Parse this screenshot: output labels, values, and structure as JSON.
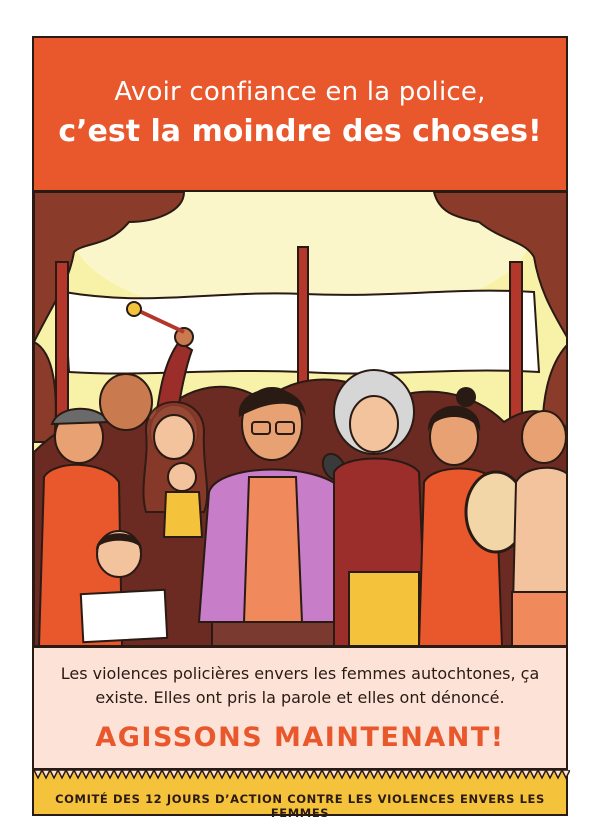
{
  "banner": {
    "line1": "Avoir confiance en la police,",
    "line2": "c’est la moindre des choses!"
  },
  "illustration": {
    "description_icon": "crowd-of-women-protest-illustration"
  },
  "info": {
    "body": "Les violences policières envers les femmes autochtones, ça existe. Elles ont pris la parole et elles ont dénoncé.",
    "cta": "AGISSONS MAINTENANT!"
  },
  "footer": {
    "text": "COMITÉ DES 12 JOURS D’ACTION CONTRE LES VIOLENCES ENVERS LES FEMMES"
  },
  "colors": {
    "orange": "#e9572c",
    "pink": "#fde3d7",
    "yellow": "#f5c23c",
    "ink": "#2a1a14"
  }
}
